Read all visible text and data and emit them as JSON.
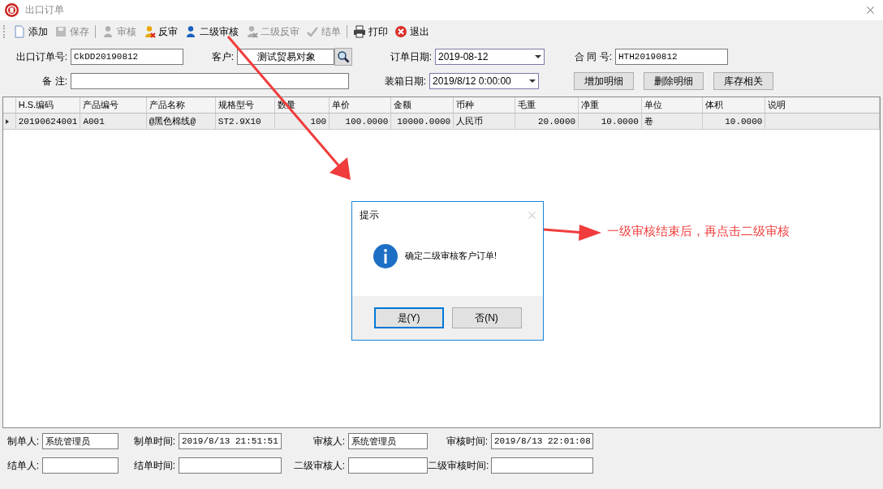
{
  "window": {
    "title": "出口订单"
  },
  "toolbar": [
    {
      "label": "添加",
      "kind": "page",
      "disabled": false,
      "separator_after": false
    },
    {
      "label": "保存",
      "kind": "disk",
      "disabled": true,
      "separator_after": true
    },
    {
      "label": "审核",
      "kind": "person",
      "disabled": true,
      "separator_after": false
    },
    {
      "label": "反审",
      "kind": "unperson",
      "disabled": false,
      "separator_after": false
    },
    {
      "label": "二级审核",
      "kind": "person",
      "disabled": false,
      "separator_after": false
    },
    {
      "label": "二级反审",
      "kind": "unperson",
      "disabled": true,
      "separator_after": false
    },
    {
      "label": "结单",
      "kind": "check",
      "disabled": true,
      "separator_after": true
    },
    {
      "label": "打印",
      "kind": "printer",
      "disabled": false,
      "separator_after": false
    },
    {
      "label": "退出",
      "kind": "exit",
      "disabled": false,
      "separator_after": false
    }
  ],
  "form": {
    "order_no": {
      "label": "出口订单号:",
      "value": "CkDD20190812"
    },
    "customer": {
      "label": "客户:",
      "value": "测试贸易对象"
    },
    "order_date": {
      "label": "订单日期:",
      "value": "2019-08-12"
    },
    "contract_no": {
      "label": "合 同 号:",
      "value": "HTH20190812"
    },
    "remark": {
      "label": "备 注:"
    },
    "packing_date": {
      "label": "装箱日期:",
      "value": "2019/8/12 0:00:00"
    },
    "buttons": [
      "增加明细",
      "删除明细",
      "库存相关"
    ]
  },
  "table": {
    "columns": [
      "H.S.编码",
      "产品编号",
      "产品名称",
      "规格型号",
      "数量",
      "单价",
      "金额",
      "币种",
      "毛重",
      "净重",
      "单位",
      "体积",
      "说明"
    ],
    "rows": [
      {
        "selected": true,
        "cells": [
          "20190624001",
          "A001",
          "@黑色棉线@",
          "ST2.9X10",
          "100",
          "100.0000",
          "10000.0000",
          "人民币",
          "20.0000",
          "10.0000",
          "卷",
          "10.0000",
          null
        ]
      }
    ]
  },
  "footer": [
    [
      {
        "label": "制单人:",
        "value": "系统管理员"
      },
      {
        "label": "制单时间:",
        "value": "2019/8/13 21:51:51"
      },
      {
        "label": "审核人:",
        "value": "系统管理员"
      },
      {
        "label": "审核时间:",
        "value": "2019/8/13 22:01:08"
      }
    ],
    [
      {
        "label": "结单人:"
      },
      {
        "label": "结单时间:"
      },
      {
        "label": "二级审核人:"
      },
      {
        "label": "二级审核时间:"
      }
    ]
  ],
  "dialog": {
    "title": "提示",
    "message": "确定二级审核客户订单!",
    "buttons": [
      {
        "label": "是(Y)",
        "selected": true
      },
      {
        "label": "否(N)",
        "selected": false
      }
    ]
  },
  "annotation": {
    "text": "一级审核结束后，再点击二级审核"
  }
}
